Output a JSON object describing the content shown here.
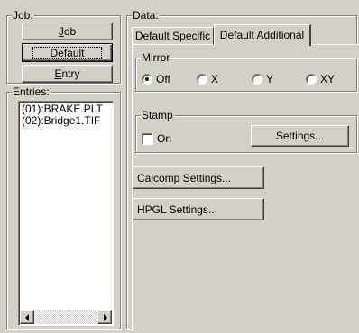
{
  "job": {
    "group_label": "Job:",
    "job_button": {
      "prefix": "",
      "mnemonic": "J",
      "suffix": "ob"
    },
    "default_button": "Default",
    "entry_button": {
      "prefix": "",
      "mnemonic": "E",
      "suffix": "ntry"
    }
  },
  "entries": {
    "group_label": "Entries:",
    "items": [
      "(01):BRAKE.PLT",
      "(02):Bridge1.TIF"
    ]
  },
  "data_panel": {
    "group_label": "Data:",
    "tabs": [
      {
        "label": "Default Specific",
        "selected": false
      },
      {
        "label": "Default Additional",
        "selected": true
      }
    ],
    "mirror": {
      "group_label": "Mirror",
      "options": [
        {
          "label": "Off",
          "selected": true
        },
        {
          "label": "X",
          "selected": false
        },
        {
          "label": "Y",
          "selected": false
        },
        {
          "label": "XY",
          "selected": false
        }
      ]
    },
    "stamp": {
      "group_label": "Stamp",
      "checkbox_label": "On",
      "checked": false,
      "settings_button": "Settings..."
    },
    "calcomp_button": "Calcomp Settings...",
    "hpgl_button": "HPGL Settings..."
  }
}
